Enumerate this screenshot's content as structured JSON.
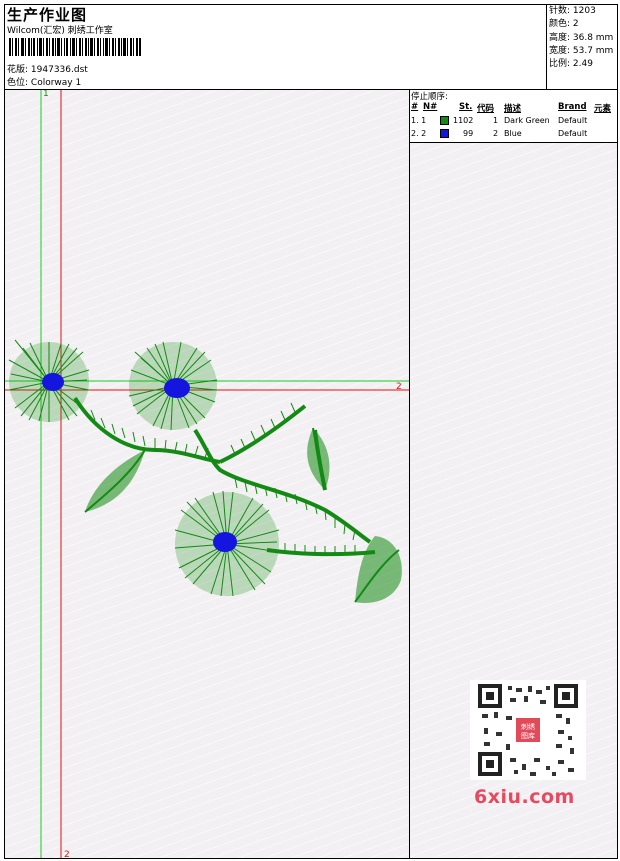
{
  "header": {
    "title": "生产作业图",
    "company": "Wilcom(汇宏) 刺绣工作室",
    "design_label": "花版:",
    "design_value": "1947336.dst",
    "colorway_label": "色位:",
    "colorway_value": "Colorway 1"
  },
  "stats": {
    "stitches": "针数: 1203",
    "colors": "颜色: 2",
    "height": "高度: 36.8 mm",
    "width": "宽度: 53.7 mm",
    "scale": "比例: 2.49"
  },
  "stop_sequence": {
    "heading": "停止顺序:",
    "columns": [
      "#",
      "N#",
      "St.",
      "代码",
      "描述",
      "Brand",
      "元素"
    ],
    "rows": [
      {
        "index": "1. 1",
        "color": "#138a13",
        "stitches": "1102",
        "code": "1",
        "desc": "Dark Green",
        "brand": "Default"
      },
      {
        "index": "2. 2",
        "color": "#1515e0",
        "stitches": "99",
        "code": "2",
        "desc": "Blue",
        "brand": "Default"
      }
    ]
  },
  "markers": {
    "green_top": "1",
    "red_right": "2",
    "red_bottom": "2"
  },
  "watermark": {
    "text": "6xiu.com",
    "seal": "刺绣图库"
  },
  "colors": {
    "thread_green": "#138a13",
    "thread_blue": "#1515e0",
    "guide_green": "#1ecb1e",
    "guide_red": "#e01010"
  }
}
